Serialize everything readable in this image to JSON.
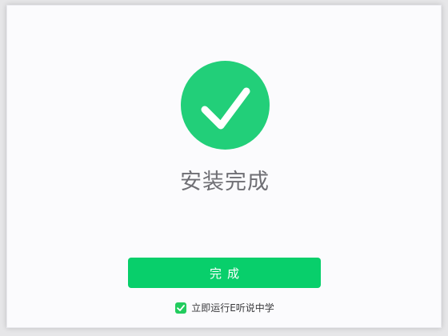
{
  "install": {
    "title": "安装完成",
    "finish_label": "完成",
    "launch_checkbox": {
      "label": "立即运行E听说中学",
      "checked": true
    }
  },
  "colors": {
    "success_circle": "#22cf79",
    "button": "#08cf6b",
    "checkbox": "#22cc5e",
    "title_text": "#6f6f74"
  },
  "icons": {
    "success": "check-circle-icon",
    "checkbox_mark": "check-icon"
  }
}
